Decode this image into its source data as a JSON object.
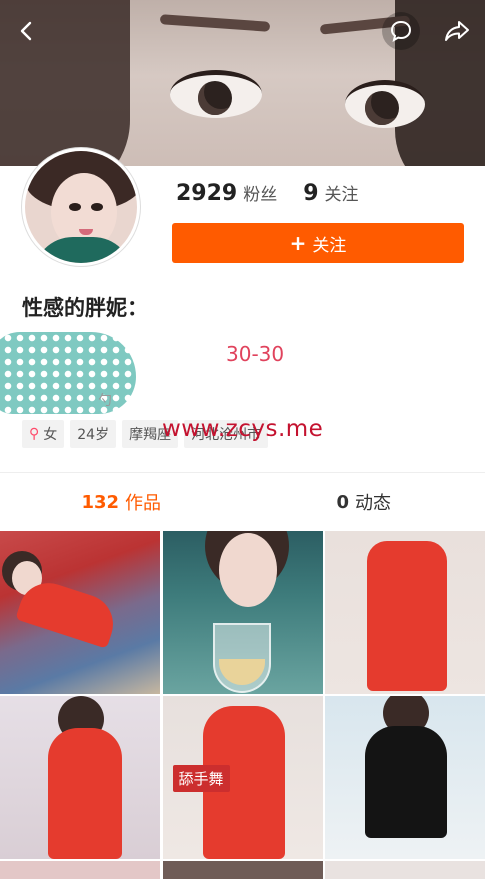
{
  "header": {
    "back_icon": "back-arrow-icon",
    "message_icon": "chat-bubble-icon",
    "share_icon": "share-icon"
  },
  "profile": {
    "followers_count": "2929",
    "followers_label": "粉丝",
    "following_count": "9",
    "following_label": "关注",
    "follow_button_plus": "+",
    "follow_button_label": "关注",
    "name": "性感的胖妮：",
    "bio": "30-30",
    "bio_fragment": "勺",
    "tags": [
      {
        "icon": "female-icon",
        "label": "女"
      },
      {
        "label": "24岁"
      },
      {
        "label": "摩羯座"
      },
      {
        "label": "河北沧州市"
      }
    ]
  },
  "watermark": "www.zcys.me",
  "tabs": [
    {
      "count": "132",
      "label": "作品",
      "active": true
    },
    {
      "count": "0",
      "label": "动态",
      "active": false
    }
  ],
  "grid": {
    "items": [
      {
        "badge": ""
      },
      {
        "badge": ""
      },
      {
        "badge": ""
      },
      {
        "badge": ""
      },
      {
        "badge": "舔手舞"
      },
      {
        "badge": ""
      }
    ]
  },
  "colors": {
    "accent": "#ff5b00",
    "bio_text": "#e0425c",
    "watermark": "#c4122f"
  }
}
